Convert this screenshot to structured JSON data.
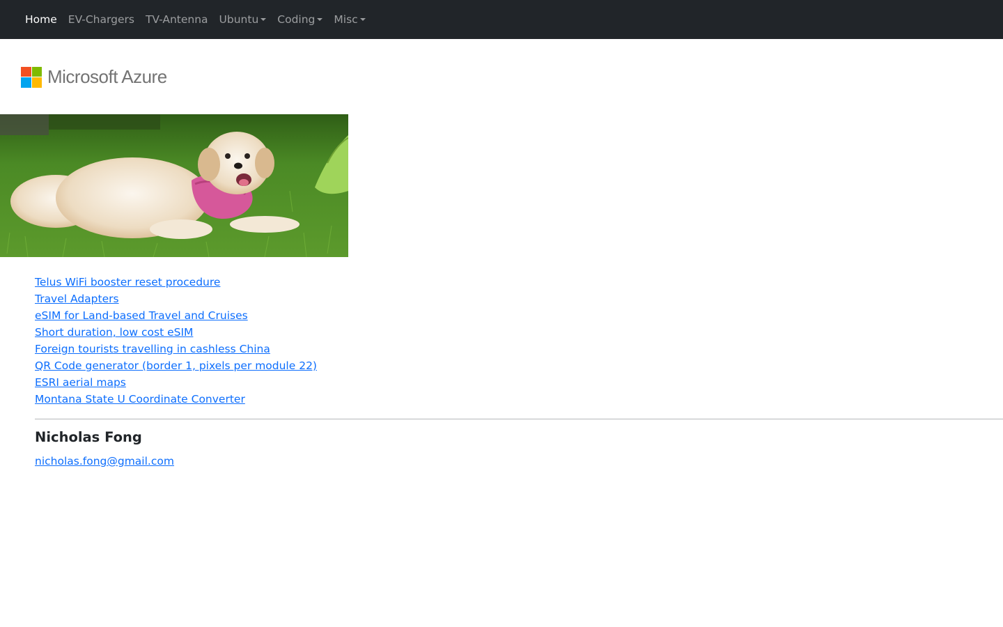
{
  "nav": {
    "items": [
      {
        "label": "Home",
        "dropdown": false,
        "active": true
      },
      {
        "label": "EV-Chargers",
        "dropdown": false,
        "active": false
      },
      {
        "label": "TV-Antenna",
        "dropdown": false,
        "active": false
      },
      {
        "label": "Ubuntu",
        "dropdown": true,
        "active": false
      },
      {
        "label": "Coding",
        "dropdown": true,
        "active": false
      },
      {
        "label": "Misc",
        "dropdown": true,
        "active": false
      }
    ]
  },
  "logo": {
    "text": "Microsoft Azure",
    "colors": [
      "#f25022",
      "#7fba00",
      "#00a4ef",
      "#ffb900"
    ]
  },
  "photo": {
    "icon": "dog-photo"
  },
  "links": [
    "Telus WiFi booster reset procedure",
    "Travel Adapters",
    "eSIM for Land-based Travel and Cruises",
    "Short duration, low cost eSIM",
    "Foreign tourists travelling in cashless China",
    "QR Code generator (border 1, pixels per module 22)",
    "ESRI aerial maps",
    "Montana State U Coordinate Converter"
  ],
  "contact": {
    "name": "Nicholas Fong",
    "email": "nicholas.fong@gmail.com"
  },
  "colors": {
    "navbar_bg": "#212529",
    "link": "#0d6efd"
  }
}
